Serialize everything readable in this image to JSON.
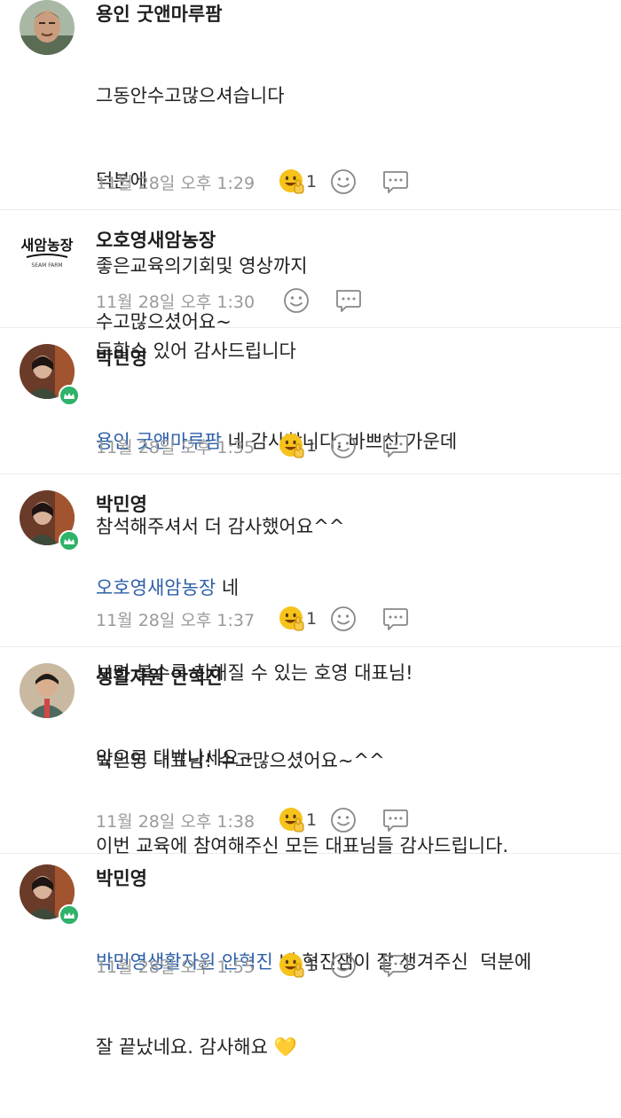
{
  "comments": [
    {
      "author": "용인 굿앤마루팜",
      "lines": [
        "그동안수고많으셔습니다",
        "덕분에",
        "좋은교육의기회및 영상까지",
        "득할수 있어 감사드립니다"
      ],
      "time": "11월 28일 오후 1:29",
      "reaction_count": "1"
    },
    {
      "author": "오호영새암농장",
      "avatar_text": "새암농장",
      "avatar_subtext": "SEAM FARM",
      "lines": [
        "수고많으셨어요~"
      ],
      "time": "11월 28일 오후 1:30"
    },
    {
      "author": "박민영",
      "mention": "용인 굿앤마루팜",
      "first_line_rest": " 네 감사합니다. 바쁘신 가운데",
      "lines": [
        "참석해주셔서 더 감사했어요^^"
      ],
      "time": "11월 28일 오후 1:35",
      "reaction_count": "1"
    },
    {
      "author": "박민영",
      "mention": "오호영새암농장",
      "first_line_rest": " 네",
      "lines": [
        "보면 볼수록 친해질 수 있는 호영 대표님!",
        "앞으로 대박나세요~"
      ],
      "time": "11월 28일 오후 1:37",
      "reaction_count": "1"
    },
    {
      "author": "생활자원 안혁진",
      "lines": [
        "박민영 대표님! 수고많으셨어요~^^",
        "이번 교육에 참여해주신 모든 대표님들 감사드립니다."
      ],
      "time": "11월 28일 오후 1:38",
      "reaction_count": "1"
    },
    {
      "author": "박민영",
      "mention": "박민영생활자원 안혁진",
      "first_line_rest": " 네 혁진샘이 잘 챙겨주신  덕분에",
      "lines": [
        "잘 끝났네요. 감사해요 💛"
      ],
      "time": "11월 28일 오후 1:55",
      "reaction_count": "1"
    }
  ],
  "colors": {
    "mention": "#2d5fa8",
    "time": "#9a9a9a",
    "badge": "#2fb26a",
    "emoji": "#f6c21c"
  },
  "icons": {
    "reaction": "thumbs-up-emoji-icon",
    "add_reaction": "smiley-icon",
    "reply": "speech-bubble-icon",
    "badge": "crown-icon"
  }
}
